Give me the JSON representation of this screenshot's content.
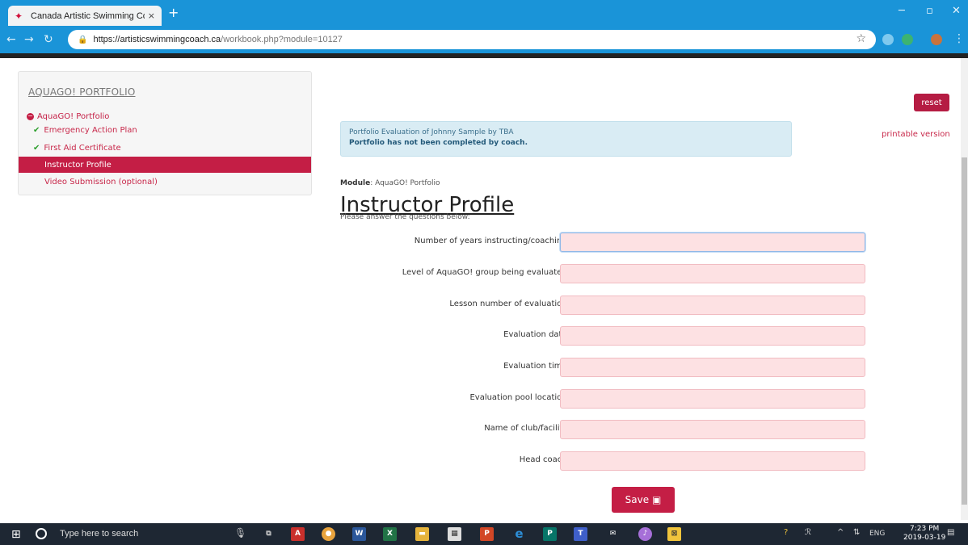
{
  "browser": {
    "tab_title": "Canada Artistic Swimming Coach",
    "tab_close": "×",
    "new_tab": "+",
    "url_host": "https://artisticswimmingcoach.ca",
    "url_path": "/workbook.php?module=10127"
  },
  "sidebar": {
    "heading": "AQUAGO! PORTFOLIO",
    "section_label": "AquaGO! Portfolio",
    "items": [
      {
        "label": "Emergency Action Plan",
        "status": "complete"
      },
      {
        "label": "First Aid Certificate",
        "status": "complete"
      },
      {
        "label": "Instructor Profile",
        "status": "active"
      },
      {
        "label": "Video Submission (optional)",
        "status": "pending"
      }
    ]
  },
  "main": {
    "reset_label": "reset",
    "printable_label": "printable version",
    "alert_line1": "Portfolio Evaluation of Johnny Sample by TBA",
    "alert_line2": "Portfolio has not been completed by coach.",
    "module_key": "Module",
    "module_value": ": AquaGO! Portfolio",
    "page_title": "Instructor Profile",
    "instructions": "Please answer the questions below:",
    "fields": [
      {
        "label": "Number of years instructing/coaching",
        "value": ""
      },
      {
        "label": "Level of AquaGO! group being evaluated",
        "value": ""
      },
      {
        "label": "Lesson number of evaluation",
        "value": ""
      },
      {
        "label": "Evaluation date",
        "value": ""
      },
      {
        "label": "Evaluation time",
        "value": ""
      },
      {
        "label": "Evaluation pool location",
        "value": ""
      },
      {
        "label": "Name of club/facility",
        "value": ""
      },
      {
        "label": "Head coach",
        "value": ""
      }
    ],
    "save_label": "Save"
  },
  "taskbar": {
    "search_placeholder": "Type here to search",
    "language": "ENG",
    "time": "7:23 PM",
    "date": "2019-03-19"
  },
  "colors": {
    "browser_blue": "#1a94d8",
    "accent_red": "#c41e45",
    "input_pink": "#fde1e3",
    "alert_blue": "#d9ecf4"
  }
}
